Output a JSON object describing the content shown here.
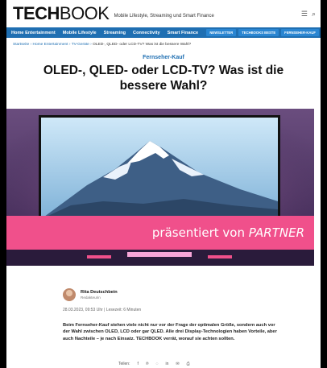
{
  "header": {
    "logo_bold": "TECH",
    "logo_light": "BOOK",
    "tagline": "Mobile Lifestyle, Streaming und Smart Finance",
    "menu_icon": "hamburger-icon",
    "search_icon": "search-icon"
  },
  "nav": {
    "items": [
      "Home Entertainment",
      "Mobile Lifestyle",
      "Streaming",
      "Connectivity",
      "Smart Finance"
    ],
    "buttons": [
      "NEWSLETTER",
      "TECHBOOKS BESTE",
      "FERNSEHER-KAUF"
    ]
  },
  "breadcrumb": {
    "trail": "Startseite › Home Entertainment › TV-Geräte ›",
    "current": "OLED-, QLED- oder LCD-TV? Was ist die bessere Wahl?"
  },
  "article": {
    "kicker": "Fernseher-Kauf",
    "title": "OLED-, QLED- oder LCD-TV? Was ist die bessere Wahl?",
    "banner_prefix": "präsentiert von ",
    "banner_partner": "PARTNER",
    "author_name": "Rita Deutschbein",
    "author_role": "Redakteurin",
    "date": "28.03.2023, 09:53 Uhr | Lesezeit: 6 Minuten",
    "lead": "Beim Fernseher-Kauf stehen viele nicht nur vor der Frage der optimalen Größe, sondern auch vor der Wahl zwischen OLED, LCD oder gar QLED. Alle drei Display-Technologien haben Vorteile, aber auch Nachteile – je nach Einsatz. TECHBOOK verrät, worauf sie achten sollten."
  },
  "share": {
    "label": "Teilen:",
    "icons": [
      "facebook-icon",
      "pinterest-icon",
      "whatsapp-icon",
      "linkedin-icon",
      "mail-icon",
      "print-icon"
    ]
  },
  "colors": {
    "brand_blue": "#1f6fb2",
    "banner_pink": "#f0508b"
  }
}
